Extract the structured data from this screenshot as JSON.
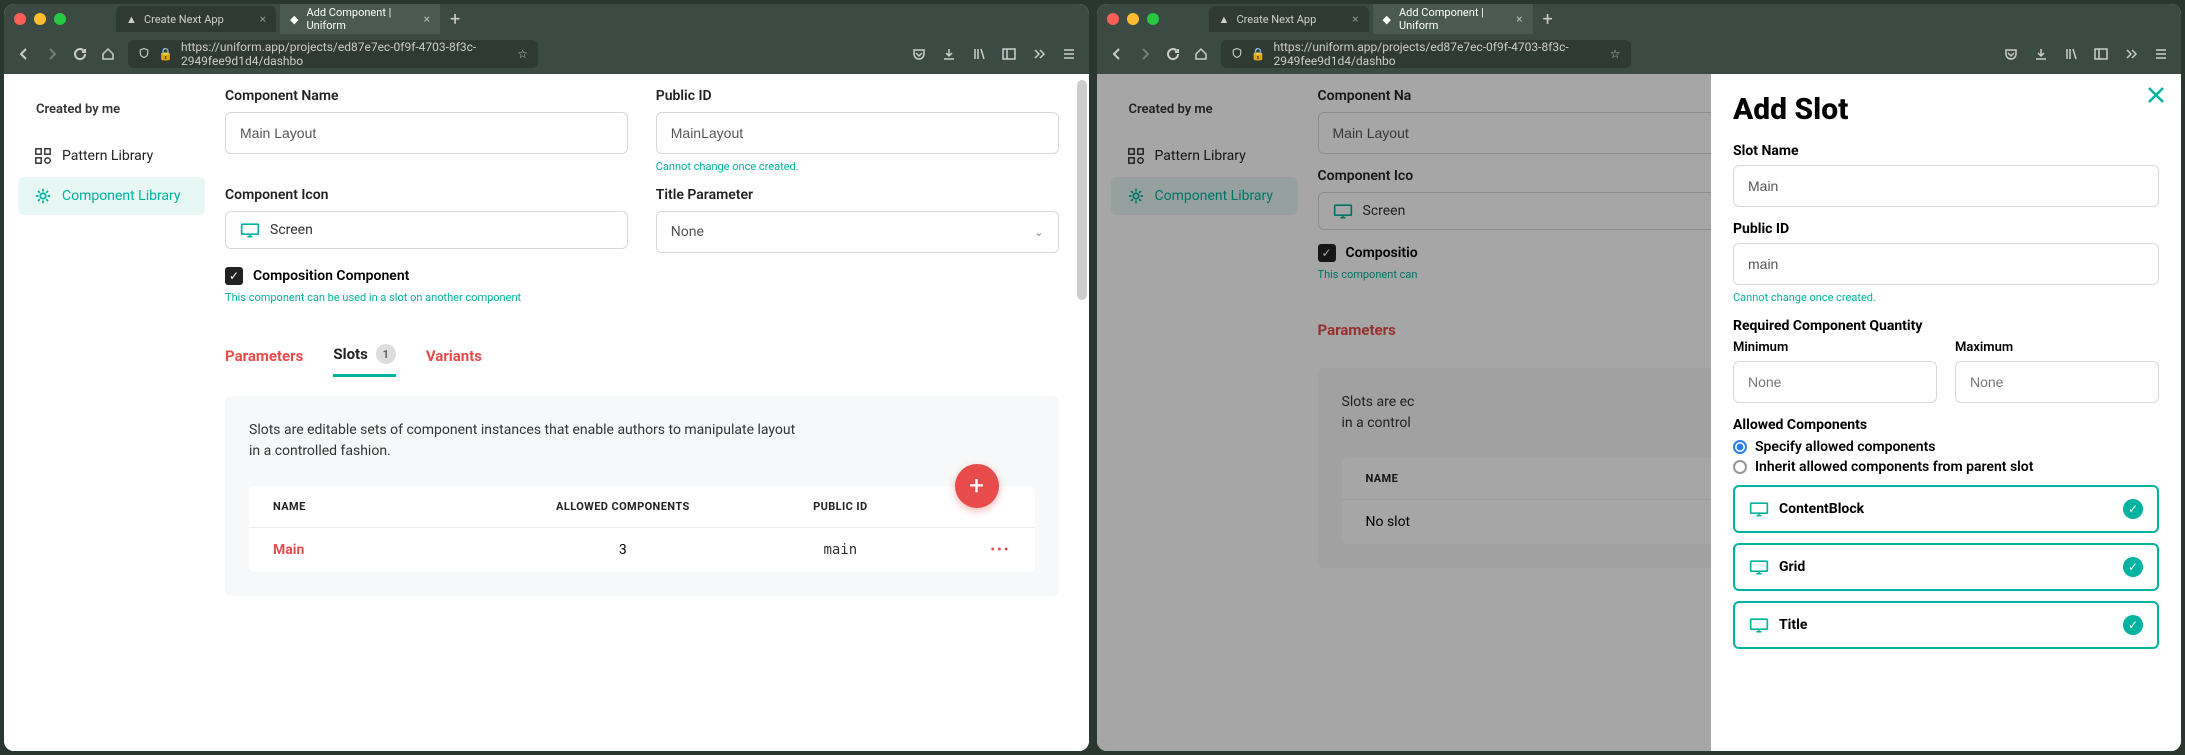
{
  "browser": {
    "tab1": "Create Next App",
    "tab2": "Add Component | Uniform",
    "url": "https://uniform.app/projects/ed87e7ec-0f9f-4703-8f3c-2949fee9d1d4/dashbo"
  },
  "sidebar": {
    "created": "Created by me",
    "pattern": "Pattern Library",
    "component": "Component Library"
  },
  "form": {
    "name_label": "Component Name",
    "name_value": "Main Layout",
    "pubid_label": "Public ID",
    "pubid_value": "MainLayout",
    "pubid_hint": "Cannot change once created.",
    "icon_label": "Component Icon",
    "icon_value": "Screen",
    "titleparam_label": "Title Parameter",
    "titleparam_value": "None",
    "composition_label": "Composition Component",
    "composition_help": "This component can be used in a slot on another component"
  },
  "ctabs": {
    "parameters": "Parameters",
    "slots": "Slots",
    "slots_count": "1",
    "variants": "Variants"
  },
  "slots": {
    "desc": "Slots are editable sets of component instances that enable authors to manipulate layout in a controlled fashion.",
    "col_name": "NAME",
    "col_allowed": "ALLOWED COMPONENTS",
    "col_pubid": "PUBLIC ID",
    "row_name": "Main",
    "row_allowed": "3",
    "row_pubid": "main",
    "empty": "No slot"
  },
  "drawer": {
    "title": "Add Slot",
    "slotname_label": "Slot Name",
    "slotname_value": "Main",
    "pubid_label": "Public ID",
    "pubid_value": "main",
    "pubid_hint": "Cannot change once created.",
    "qty_label": "Required Component Quantity",
    "min_label": "Minimum",
    "max_label": "Maximum",
    "none": "None",
    "allowed_label": "Allowed Components",
    "radio_specify": "Specify allowed components",
    "radio_inherit": "Inherit allowed components from parent slot",
    "c1": "ContentBlock",
    "c2": "Grid",
    "c3": "Title"
  }
}
